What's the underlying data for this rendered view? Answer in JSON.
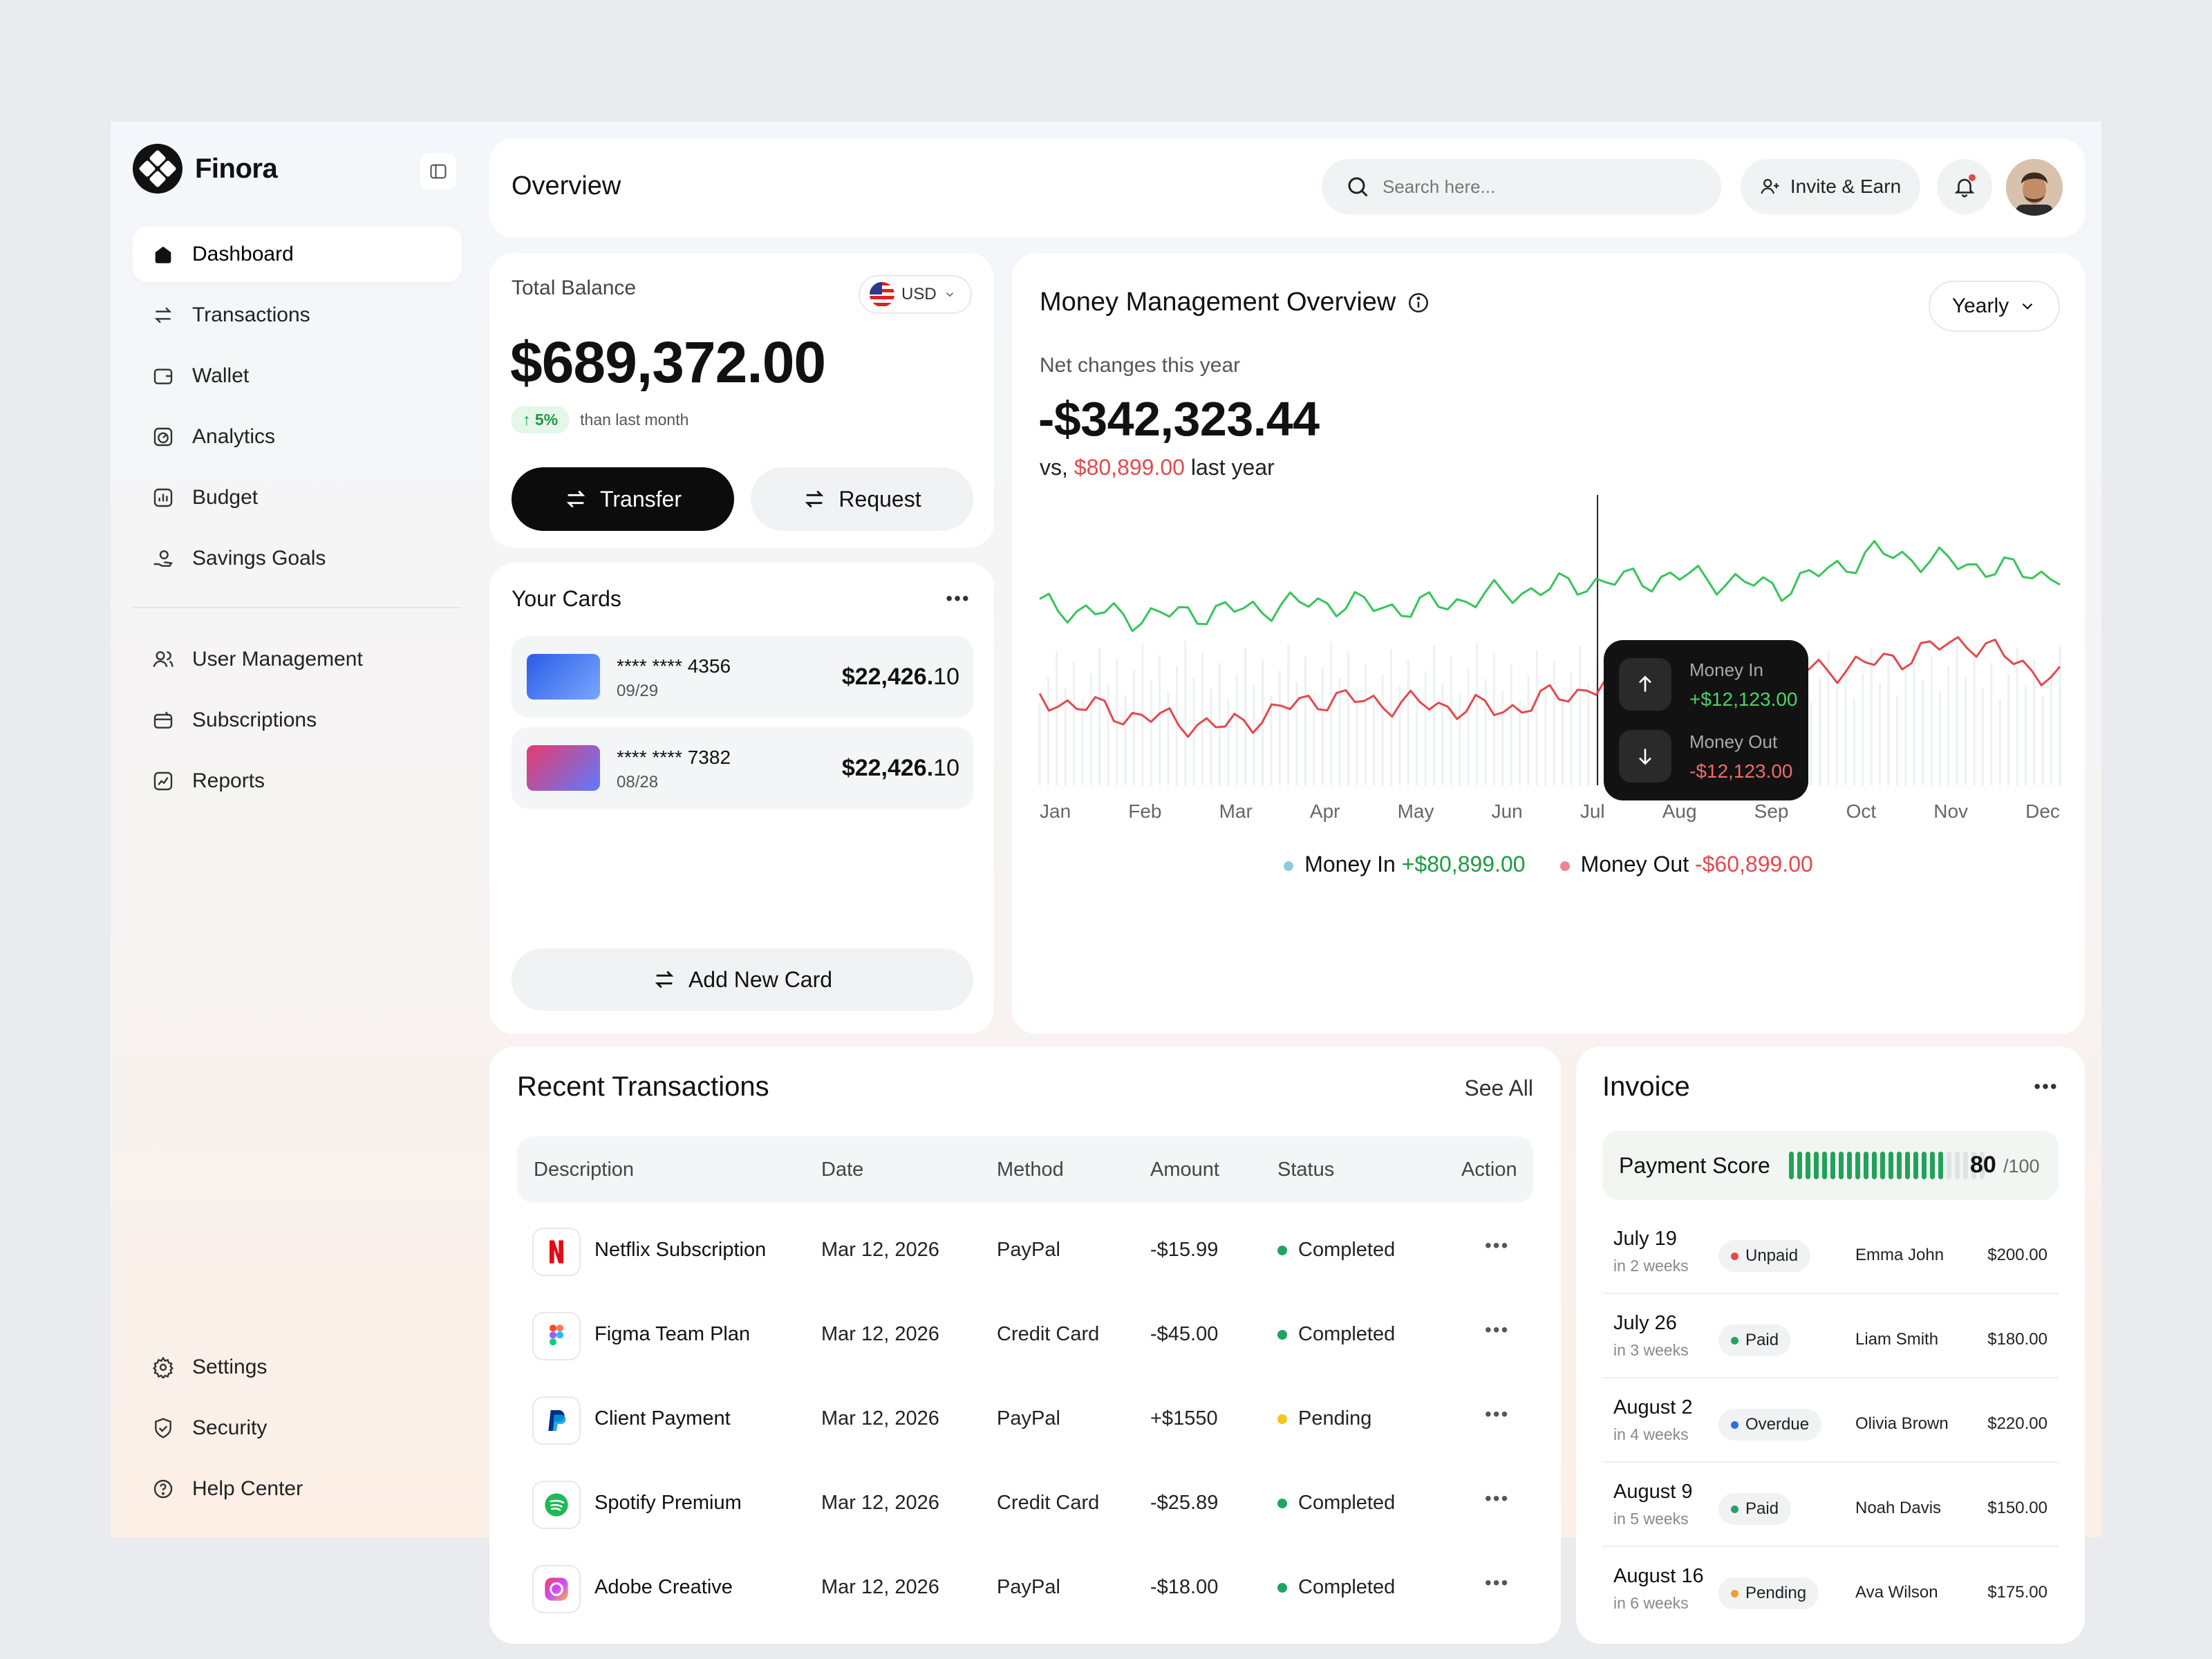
{
  "brand": {
    "name": "Finora"
  },
  "nav": {
    "main": [
      {
        "label": "Dashboard",
        "icon": "home-icon",
        "active": true
      },
      {
        "label": "Transactions",
        "icon": "transfer-icon"
      },
      {
        "label": "Wallet",
        "icon": "wallet-icon"
      },
      {
        "label": "Analytics",
        "icon": "analytics-icon"
      },
      {
        "label": "Budget",
        "icon": "budget-icon"
      },
      {
        "label": "Savings Goals",
        "icon": "savings-icon"
      }
    ],
    "secondary": [
      {
        "label": "User Management",
        "icon": "users-icon"
      },
      {
        "label": "Subscriptions",
        "icon": "subscriptions-icon"
      },
      {
        "label": "Reports",
        "icon": "reports-icon"
      }
    ],
    "bottom": [
      {
        "label": "Settings",
        "icon": "gear-icon"
      },
      {
        "label": "Security",
        "icon": "shield-icon"
      },
      {
        "label": "Help Center",
        "icon": "help-icon"
      }
    ]
  },
  "header": {
    "title": "Overview",
    "search_placeholder": "Search here...",
    "invite_label": "Invite & Earn"
  },
  "balance": {
    "label": "Total Balance",
    "currency": "USD",
    "amount": "$689,372.00",
    "change": "5%",
    "change_text": "than last month",
    "transfer_label": "Transfer",
    "request_label": "Request"
  },
  "cards": {
    "title": "Your Cards",
    "items": [
      {
        "number": "**** **** 4356",
        "expiry": "09/29",
        "amount_main": "$22,426.",
        "amount_cents": "10",
        "colors": [
          "#2b5ce6",
          "#7aa7ff"
        ]
      },
      {
        "number": "**** **** 7382",
        "expiry": "08/28",
        "amount_main": "$22,426.",
        "amount_cents": "10",
        "colors": [
          "#e83a6c",
          "#5c7cff"
        ]
      }
    ],
    "add_label": "Add New Card"
  },
  "money": {
    "title": "Money Management Overview",
    "period": "Yearly",
    "net_label": "Net changes this year",
    "net_amount": "-$342,323.44",
    "vs_prefix": "vs,",
    "vs_amount": "$80,899.00",
    "vs_suffix": "last year",
    "legend_in_label": "Money In",
    "legend_in_value": "+$80,899.00",
    "legend_out_label": "Money Out",
    "legend_out_value": "-$60,899.00",
    "tooltip": {
      "in_label": "Money In",
      "in_value": "+$12,123.00",
      "out_label": "Money Out",
      "out_value": "-$12,123.00"
    },
    "colors": {
      "in": "#37c55a",
      "out": "#e5484d",
      "in_dot": "#8ec9e0",
      "out_dot": "#f0868a"
    }
  },
  "chart_data": {
    "type": "line",
    "title": "Money Management Overview",
    "categories": [
      "Jan",
      "Feb",
      "Mar",
      "Apr",
      "May",
      "Jun",
      "Jul",
      "Aug",
      "Sep",
      "Oct",
      "Nov",
      "Dec"
    ],
    "series": [
      {
        "name": "Money In",
        "values": [
          62,
          58,
          60,
          63,
          61,
          66,
          70,
          72,
          68,
          80,
          76,
          72
        ]
      },
      {
        "name": "Money Out",
        "values": [
          30,
          24,
          20,
          30,
          28,
          26,
          34,
          44,
          38,
          42,
          50,
          36
        ]
      }
    ],
    "grid": false,
    "legend": "bottom"
  },
  "transactions": {
    "title": "Recent Transactions",
    "see_all": "See All",
    "columns": [
      "Description",
      "Date",
      "Method",
      "Amount",
      "Status",
      "Action"
    ],
    "rows": [
      {
        "desc": "Netflix Subscription",
        "date": "Mar 12, 2026",
        "method": "PayPal",
        "amount": "-$15.99",
        "status": "Completed",
        "logo": "netflix-icon"
      },
      {
        "desc": "Figma Team Plan",
        "date": "Mar 12, 2026",
        "method": "Credit Card",
        "amount": "-$45.00",
        "status": "Completed",
        "logo": "figma-icon"
      },
      {
        "desc": "Client Payment",
        "date": "Mar 12, 2026",
        "method": "PayPal",
        "amount": "+$1550",
        "status": "Pending",
        "logo": "paypal-icon"
      },
      {
        "desc": "Spotify Premium",
        "date": "Mar 12, 2026",
        "method": "Credit Card",
        "amount": "-$25.89",
        "status": "Completed",
        "logo": "spotify-icon"
      },
      {
        "desc": "Adobe Creative",
        "date": "Mar 12, 2026",
        "method": "PayPal",
        "amount": "-$18.00",
        "status": "Completed",
        "logo": "adobe-icon"
      }
    ],
    "status_colors": {
      "Completed": "#1fa463",
      "Pending": "#f5c518"
    }
  },
  "invoice": {
    "title": "Invoice",
    "score_label": "Payment Score",
    "score": "80",
    "score_max": "/100",
    "score_fraction": 0.8,
    "rows": [
      {
        "date": "July 19",
        "sub": "in 2 weeks",
        "status": "Unpaid",
        "name": "Emma John",
        "amount": "$200.00",
        "color": "#e5484d"
      },
      {
        "date": "July 26",
        "sub": "in 3 weeks",
        "status": "Paid",
        "name": "Liam Smith",
        "amount": "$180.00",
        "color": "#1fa463"
      },
      {
        "date": "August 2",
        "sub": "in 4 weeks",
        "status": "Overdue",
        "name": "Olivia Brown",
        "amount": "$220.00",
        "color": "#2f6fe0"
      },
      {
        "date": "August 9",
        "sub": "in 5 weeks",
        "status": "Paid",
        "name": "Noah Davis",
        "amount": "$150.00",
        "color": "#1fa463"
      },
      {
        "date": "August 16",
        "sub": "in 6 weeks",
        "status": "Pending",
        "name": "Ava Wilson",
        "amount": "$175.00",
        "color": "#f59e2c"
      }
    ]
  }
}
